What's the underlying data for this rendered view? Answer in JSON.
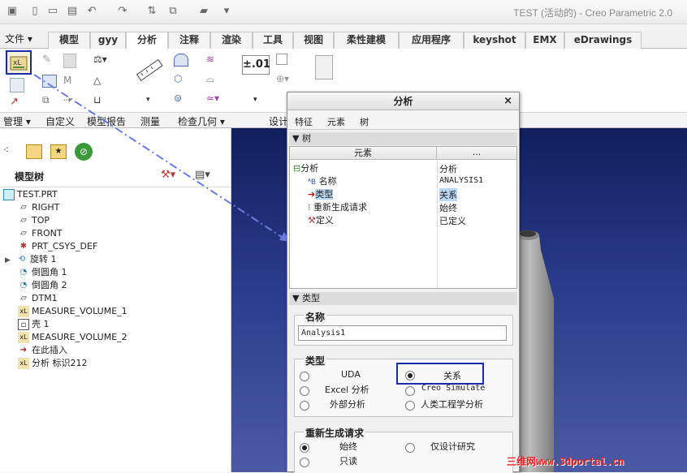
{
  "window": {
    "title": "TEST (活动的) - Creo Parametric 2.0"
  },
  "menu": {
    "file": "文件"
  },
  "tabs": [
    "模型",
    "gyy",
    "分析",
    "注释",
    "渲染",
    "工具",
    "视图",
    "柔性建模",
    "应用程序",
    "keyshot",
    "EMX",
    "eDrawings"
  ],
  "ribbon_groups": [
    "管理",
    "自定义",
    "模型报告",
    "测量",
    "检查几何",
    "设计"
  ],
  "ribbon": {
    "tolerance_label": "±.01"
  },
  "model_tree": {
    "title": "模型树",
    "items": [
      "TEST.PRT",
      "RIGHT",
      "TOP",
      "FRONT",
      "PRT_CSYS_DEF",
      "旋转 1",
      "倒圆角 1",
      "倒圆角 2",
      "DTM1",
      "MEASURE_VOLUME_1",
      "壳 1",
      "MEASURE_VOLUME_2",
      "在此插入",
      "分析 标识212"
    ]
  },
  "dialog": {
    "title": "分析",
    "tabs": [
      "特征",
      "元素",
      "树"
    ],
    "tree_section": "树",
    "col_element": "元素",
    "col_value": "...",
    "rows": [
      {
        "name": "分析",
        "value": "分析"
      },
      {
        "name": "名称",
        "value": "ANALYSIS1"
      },
      {
        "name": "类型",
        "value": "关系"
      },
      {
        "name": "重新生成请求",
        "value": "始终"
      },
      {
        "name": "定义",
        "value": "已定义"
      }
    ],
    "type_section": "类型",
    "name_group": "名称",
    "name_value": "Analysis1",
    "type_group": "类型",
    "type_options": [
      "UDA",
      "关系",
      "Excel 分析",
      "Creo Simulate",
      "外部分析",
      "人类工程学分析"
    ],
    "regen_group": "重新生成请求",
    "regen_options": [
      "始终",
      "仅设计研究",
      "只读"
    ]
  },
  "watermark": "三维网www.3dportal.cn"
}
